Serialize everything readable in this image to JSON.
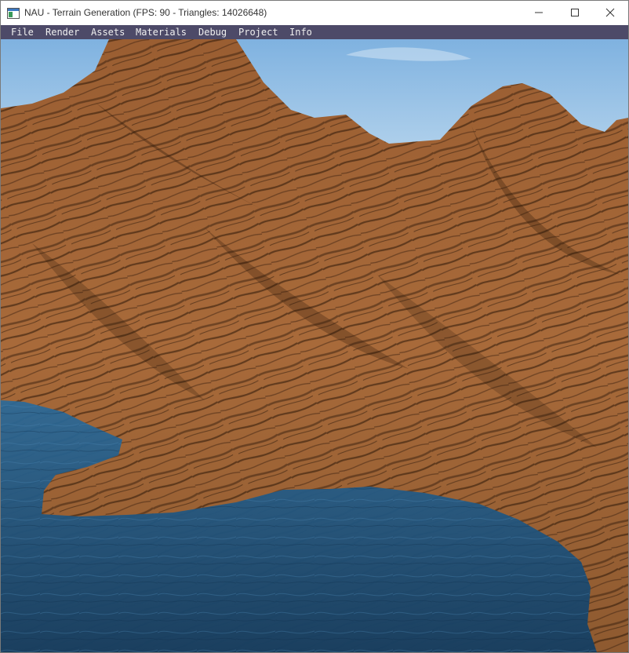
{
  "window": {
    "title": "NAU - Terrain Generation (FPS: 90 - Triangles: 14026648)"
  },
  "menu": {
    "items": [
      "File",
      "Render",
      "Assets",
      "Materials",
      "Debug",
      "Project",
      "Info"
    ]
  },
  "viewport": {
    "scene": "terrain-render",
    "colors": {
      "sky_top": "#7fb2e0",
      "sky_bottom": "#c4ddf0",
      "terrain_light": "#a86a3a",
      "terrain_dark": "#2a1608",
      "water": "#1d4f78"
    }
  },
  "icons": {
    "app": "app-window-icon",
    "minimize": "minimize-icon",
    "maximize": "maximize-icon",
    "close": "close-icon"
  }
}
